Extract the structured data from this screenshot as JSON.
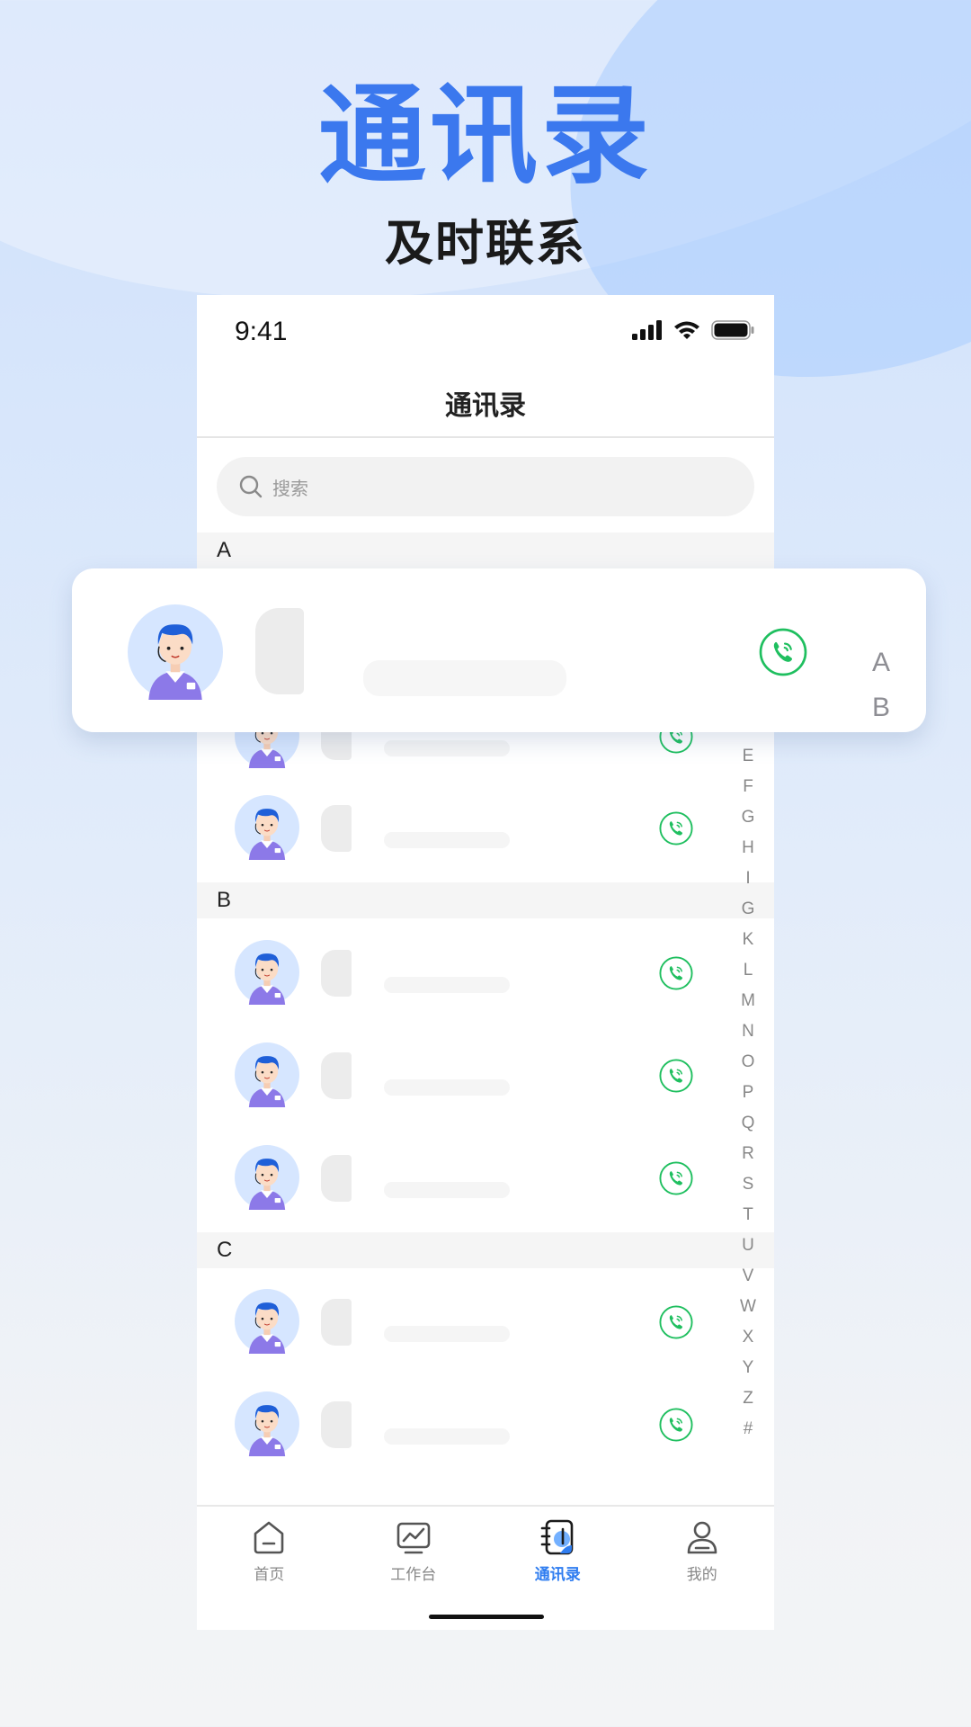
{
  "hero": {
    "title": "通讯录",
    "subtitle": "及时联系"
  },
  "status_bar": {
    "time": "9:41"
  },
  "nav": {
    "title": "通讯录"
  },
  "search": {
    "placeholder": "搜索"
  },
  "sections": [
    {
      "letter": "A",
      "contacts": 3
    },
    {
      "letter": "B",
      "contacts": 3
    },
    {
      "letter": "C",
      "contacts": 2
    }
  ],
  "index_bar": [
    "E",
    "F",
    "G",
    "H",
    "I",
    "G",
    "K",
    "L",
    "M",
    "N",
    "O",
    "P",
    "Q",
    "R",
    "S",
    "T",
    "U",
    "V",
    "W",
    "X",
    "Y",
    "Z",
    "#"
  ],
  "floating_card": {
    "index_letters": [
      "A",
      "B"
    ]
  },
  "tabbar": {
    "items": [
      {
        "label": "首页",
        "icon": "home-icon"
      },
      {
        "label": "工作台",
        "icon": "workbench-icon"
      },
      {
        "label": "通讯录",
        "icon": "contacts-icon",
        "active": true
      },
      {
        "label": "我的",
        "icon": "profile-icon"
      }
    ]
  },
  "colors": {
    "accent": "#3b78ee",
    "call_green": "#1fbf5f",
    "tab_active": "#2f7df0",
    "avatar_bg": "#d6e6ff",
    "avatar_shirt": "#8c79e8"
  }
}
